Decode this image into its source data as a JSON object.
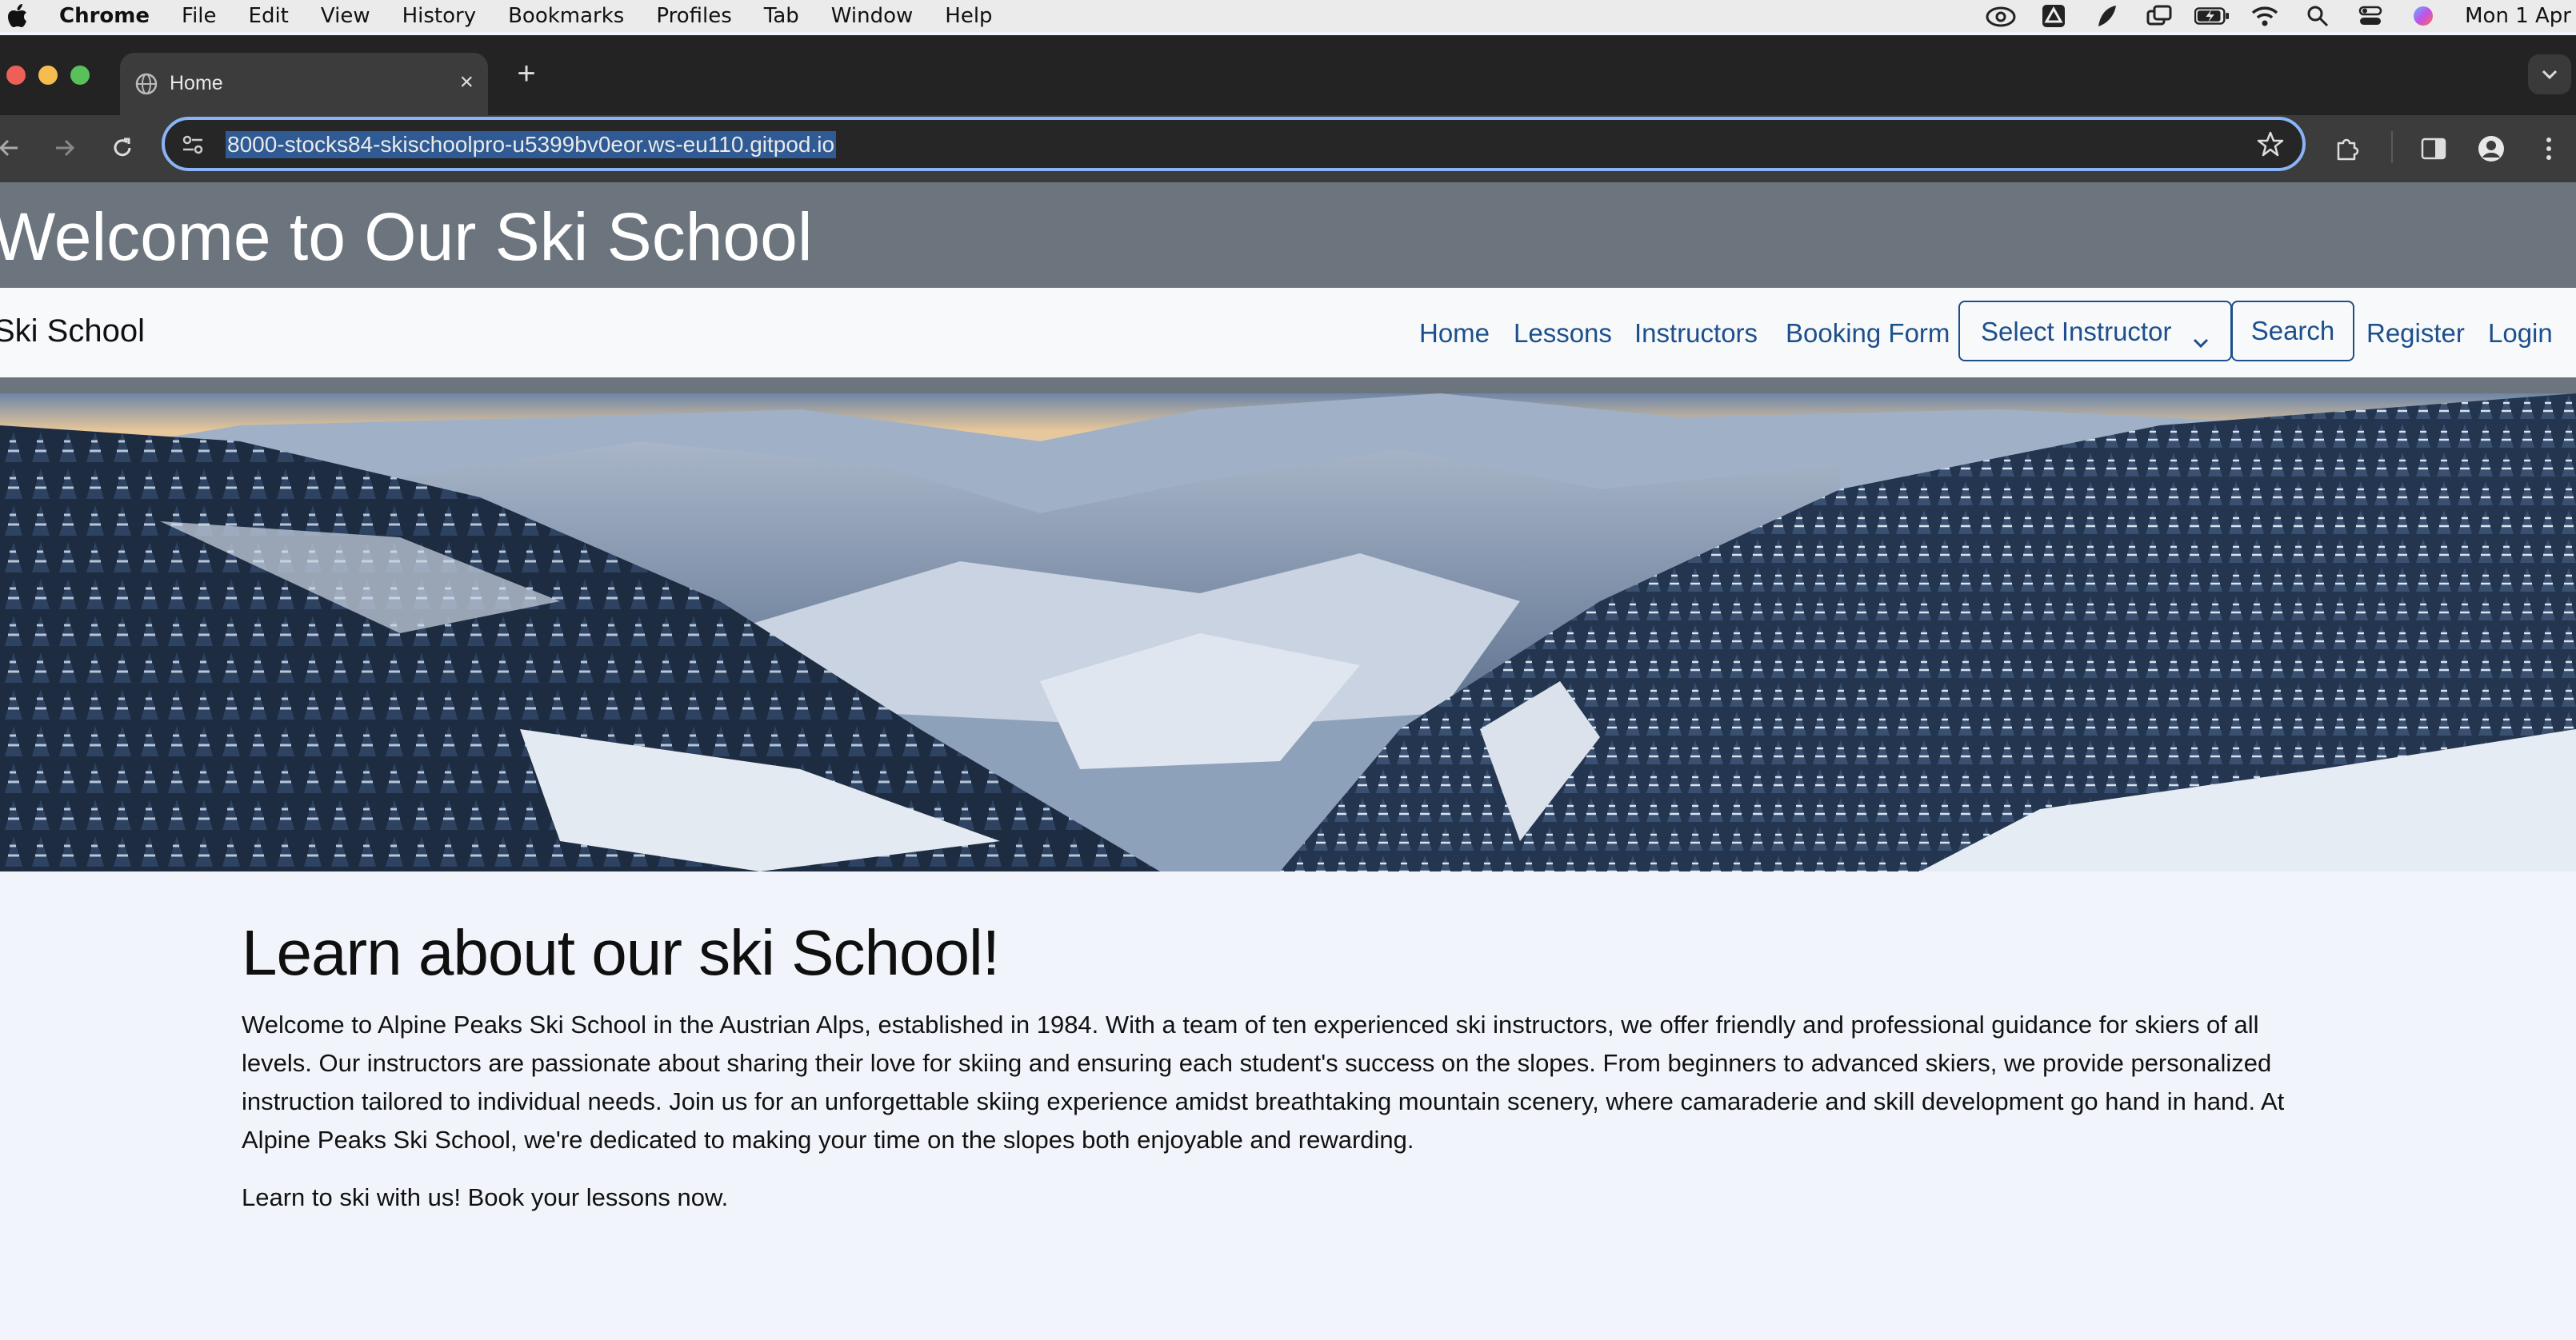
{
  "menubar": {
    "app_name": "Chrome",
    "items": [
      "File",
      "Edit",
      "View",
      "History",
      "Bookmarks",
      "Profiles",
      "Tab",
      "Window",
      "Help"
    ],
    "clock": "Mon 1 Apr"
  },
  "browser": {
    "tab_title": "Home",
    "url": "8000-stocks84-skischoolpro-u5399bv0eor.ws-eu110.gitpod.io"
  },
  "page": {
    "header_title": "Welcome to Our Ski School",
    "brand": "Ski School",
    "nav": {
      "home": "Home",
      "lessons": "Lessons",
      "instructors": "Instructors",
      "booking_form": "Booking Form",
      "select_instructor": "Select Instructor",
      "search": "Search",
      "register": "Register",
      "login": "Login"
    },
    "content": {
      "heading": "Learn about our ski School!",
      "intro": "Welcome to Alpine Peaks Ski School in the Austrian Alps, established in 1984. With a team of ten experienced ski instructors, we offer friendly and professional guidance for skiers of all levels. Our instructors are passionate about sharing their love for skiing and ensuring each student's success on the slopes. From beginners to advanced skiers, we provide personalized instruction tailored to individual needs. Join us for an unforgettable skiing experience amidst breathtaking mountain scenery, where camaraderie and skill development go hand in hand. At Alpine Peaks Ski School, we're dedicated to making your time on the slopes both enjoyable and rewarding.",
      "cta": "Learn to ski with us! Book your lessons now."
    }
  },
  "colors": {
    "header_bg": "#6c757d",
    "link": "#1c4f8c",
    "page_bg": "#f1f4fa",
    "omnibox_focus": "#8ab4f8"
  }
}
